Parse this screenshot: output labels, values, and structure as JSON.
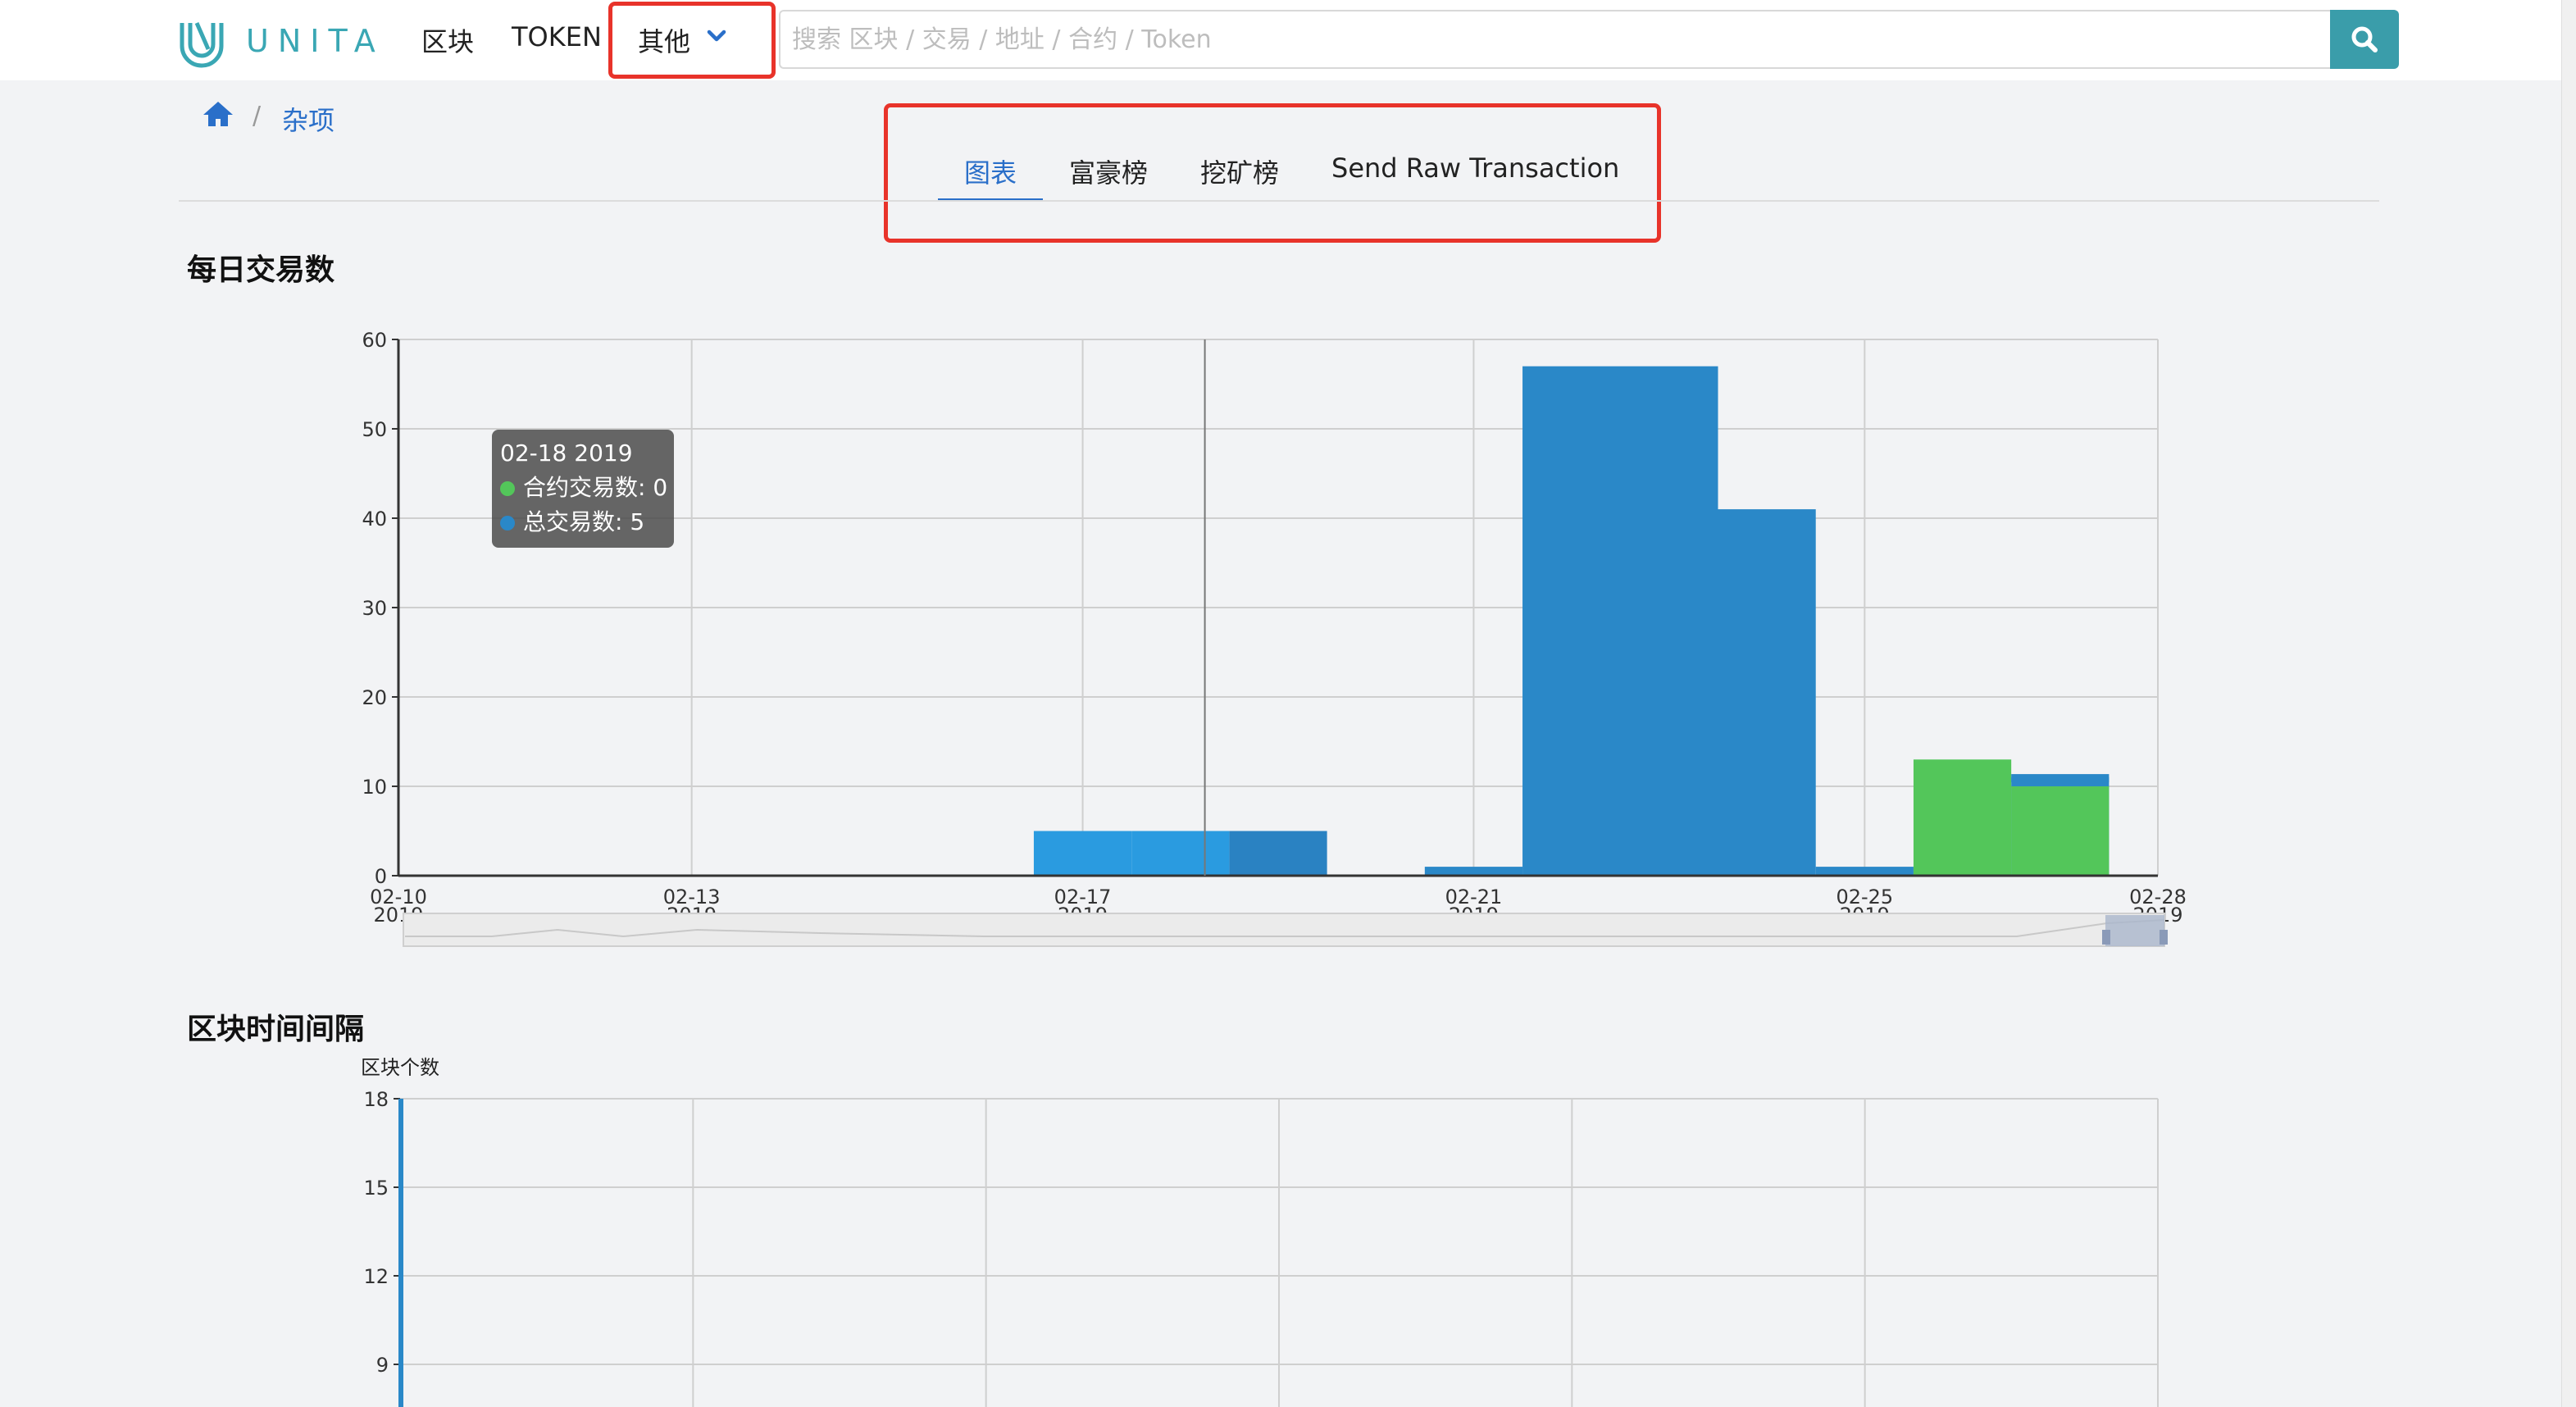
{
  "app": {
    "brand": "UNITA"
  },
  "nav": {
    "block": "区块",
    "token": "TOKEN",
    "other": "其他"
  },
  "search": {
    "placeholder": "搜索 区块 / 交易 / 地址 / 合约 / Token",
    "value": ""
  },
  "icons": {
    "logo": "unita-logo-icon",
    "chevron": "chevron-down-icon",
    "search": "search-icon",
    "home": "home-icon"
  },
  "breadcrumb": {
    "current": "杂项",
    "separator": "/"
  },
  "tabs": [
    {
      "label": "图表",
      "active": true
    },
    {
      "label": "富豪榜",
      "active": false
    },
    {
      "label": "挖矿榜",
      "active": false
    },
    {
      "label": "Send Raw Transaction",
      "active": false
    }
  ],
  "colors": {
    "accent": "#2a6fc9",
    "contract_series": "#53c65a",
    "total_series": "#2a88c8",
    "highlight_box": "#e8332a",
    "search_button": "#3a9daa"
  },
  "chart_data": [
    {
      "type": "bar",
      "title": "每日交易数",
      "ylim": [
        0,
        60
      ],
      "y_ticks": [
        0,
        10,
        20,
        30,
        40,
        50,
        60
      ],
      "x_ticks": [
        {
          "date": "2019-02-10",
          "label": "02-10",
          "year": "2019"
        },
        {
          "date": "2019-02-13",
          "label": "02-13",
          "year": "2019"
        },
        {
          "date": "2019-02-17",
          "label": "02-17",
          "year": "2019"
        },
        {
          "date": "2019-02-21",
          "label": "02-21",
          "year": "2019"
        },
        {
          "date": "2019-02-25",
          "label": "02-25",
          "year": "2019"
        },
        {
          "date": "2019-02-28",
          "label": "02-28",
          "year": "2019"
        }
      ],
      "xlim": [
        "2019-02-10",
        "2019-02-28"
      ],
      "grid": true,
      "series": [
        {
          "name": "合约交易数",
          "points": [
            {
              "date": "2019-02-18",
              "value": 0
            },
            {
              "date": "2019-02-26",
              "value": 13
            },
            {
              "date": "2019-02-27",
              "value": 10
            }
          ]
        },
        {
          "name": "总交易数",
          "points": [
            {
              "date": "2019-02-17",
              "value": 5
            },
            {
              "date": "2019-02-18",
              "value": 5
            },
            {
              "date": "2019-02-19",
              "value": 5
            },
            {
              "date": "2019-02-21",
              "value": 1
            },
            {
              "date": "2019-02-22",
              "value": 57
            },
            {
              "date": "2019-02-24",
              "value": 41
            },
            {
              "date": "2019-02-25",
              "value": 1
            },
            {
              "date": "2019-02-27",
              "value": 11
            }
          ]
        }
      ],
      "tooltip": {
        "date": "02-18 2019",
        "rows": [
          {
            "label": "合约交易数: 0",
            "color": "#53c65a"
          },
          {
            "label": "总交易数: 5",
            "color": "#2a88c8"
          }
        ]
      }
    },
    {
      "type": "bar",
      "title": "区块时间间隔",
      "ylabel": "区块个数",
      "y_ticks": [
        9,
        12,
        15,
        18
      ],
      "ylim": [
        0,
        18
      ]
    }
  ]
}
